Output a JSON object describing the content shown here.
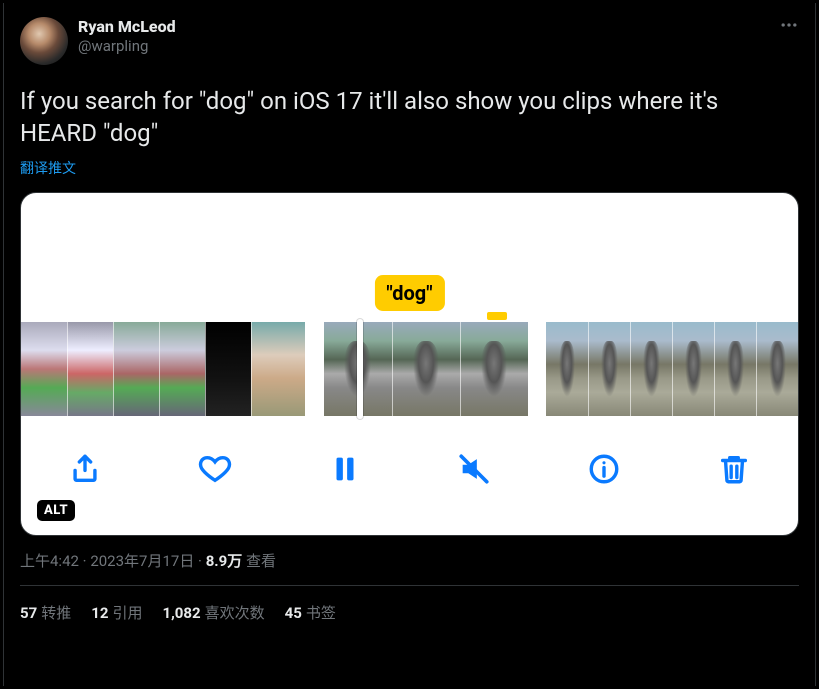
{
  "author": {
    "display_name": "Ryan McLeod",
    "handle": "@warpling"
  },
  "body_text": "If you search for \"dog\" on iOS 17 it'll also show you clips where it's HEARD \"dog\"",
  "translate_label": "翻译推文",
  "media": {
    "tooltip_text": "\"dog\"",
    "alt_badge": "ALT"
  },
  "meta": {
    "time": "上午4:42",
    "date": "2023年7月17日",
    "views_value": "8.9万",
    "views_label": "查看"
  },
  "stats": {
    "retweet_count": "57",
    "retweet_label": "转推",
    "quote_count": "12",
    "quote_label": "引用",
    "like_count": "1,082",
    "like_label": "喜欢次数",
    "bookmark_count": "45",
    "bookmark_label": "书签"
  }
}
